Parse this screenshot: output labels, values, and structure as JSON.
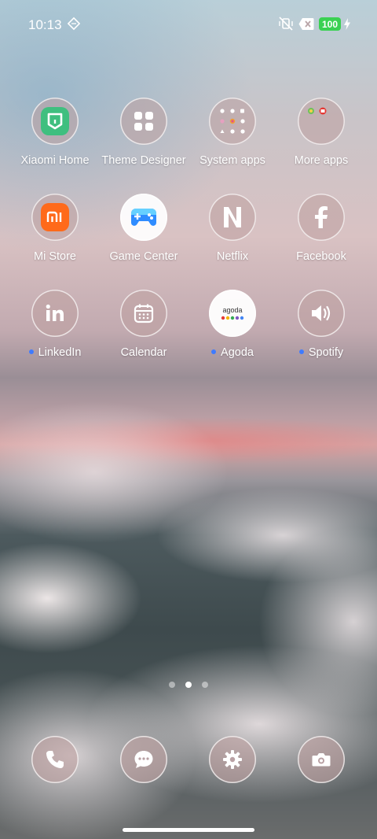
{
  "status_bar": {
    "time": "10:13",
    "battery_level": "100",
    "icons": [
      "settings-diamond-icon",
      "mute-vibrate-icon",
      "close-box-icon",
      "charging-bolt-icon"
    ]
  },
  "apps": [
    {
      "label": "Xiaomi Home",
      "icon": "xiaomi-home-icon",
      "new": false
    },
    {
      "label": "Theme Designer",
      "icon": "four-squares-icon",
      "new": false
    },
    {
      "label": "System apps",
      "icon": "folder-icon",
      "new": false
    },
    {
      "label": "More apps",
      "icon": "folder-icon",
      "new": false
    },
    {
      "label": "Mi Store",
      "icon": "mi-store-icon",
      "new": false
    },
    {
      "label": "Game Center",
      "icon": "gamepad-icon",
      "new": false
    },
    {
      "label": "Netflix",
      "icon": "netflix-icon",
      "new": false
    },
    {
      "label": "Facebook",
      "icon": "facebook-icon",
      "new": false
    },
    {
      "label": "LinkedIn",
      "icon": "linkedin-icon",
      "new": true
    },
    {
      "label": "Calendar",
      "icon": "calendar-icon",
      "new": false
    },
    {
      "label": "Agoda",
      "icon": "agoda-icon",
      "new": true
    },
    {
      "label": "Spotify",
      "icon": "speaker-icon",
      "new": true
    }
  ],
  "agoda_logo_text": "agoda",
  "pager": {
    "pages": 3,
    "current": 2
  },
  "dock": [
    "phone-icon",
    "messages-icon",
    "settings-icon",
    "camera-icon"
  ],
  "colors": {
    "battery": "#3ad152",
    "new_app_dot": "#3f7bff",
    "xiaomi_home_green": "#3fbf7f",
    "mi_store_orange": "#ff6a1a",
    "game_center_blue": "#2f8cff"
  }
}
